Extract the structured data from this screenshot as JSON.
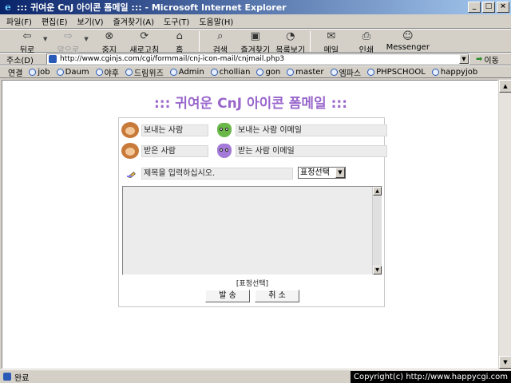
{
  "window": {
    "title": "::: 귀여운 CnJ 아이콘 폼메일 ::: - Microsoft Internet Explorer",
    "buttons": [
      "_",
      "□",
      "×"
    ]
  },
  "menu": [
    "파일(F)",
    "편집(E)",
    "보기(V)",
    "즐겨찾기(A)",
    "도구(T)",
    "도움말(H)"
  ],
  "toolbar": {
    "back": "뒤로",
    "forward": "앞으로",
    "stop": "중지",
    "refresh": "새로고침",
    "home": "홈",
    "search": "검색",
    "favorites": "즐겨찾기",
    "history": "목록보기",
    "mail": "메일",
    "print": "인쇄",
    "messenger": "Messenger"
  },
  "address": {
    "label": "주소(D)",
    "url": "http://www.cginjs.com/cgi/formmail/cnj-icon-mail/cnjmail.php3",
    "go": "이동"
  },
  "links": {
    "label": "연결",
    "items": [
      "job",
      "Daum",
      "야후",
      "드림위즈",
      "Admin",
      "chollian",
      "gon",
      "master",
      "엠파스",
      "PHPSCHOOL",
      "happyjob"
    ]
  },
  "page": {
    "title": "::: 귀여운 CnJ 아이콘 폼메일 :::",
    "sender_name": "보내는 사람",
    "sender_email": "보내는 사람 이메일",
    "recipient_name": "받은 사람",
    "recipient_email": "받는 사람 이메일",
    "subject_placeholder": "제목을 입력하십시오.",
    "emoticon_select": "표정선택",
    "emoticon_link": "[표정선택]",
    "send_button": "발 송",
    "cancel_button": "취 소"
  },
  "status": {
    "text": "완료",
    "copyright": "Copyright(c) http://www.happycgi.com"
  },
  "colors": {
    "title_purple": "#9966cc",
    "titlebar_start": "#0a246a",
    "titlebar_end": "#a6caf0"
  }
}
